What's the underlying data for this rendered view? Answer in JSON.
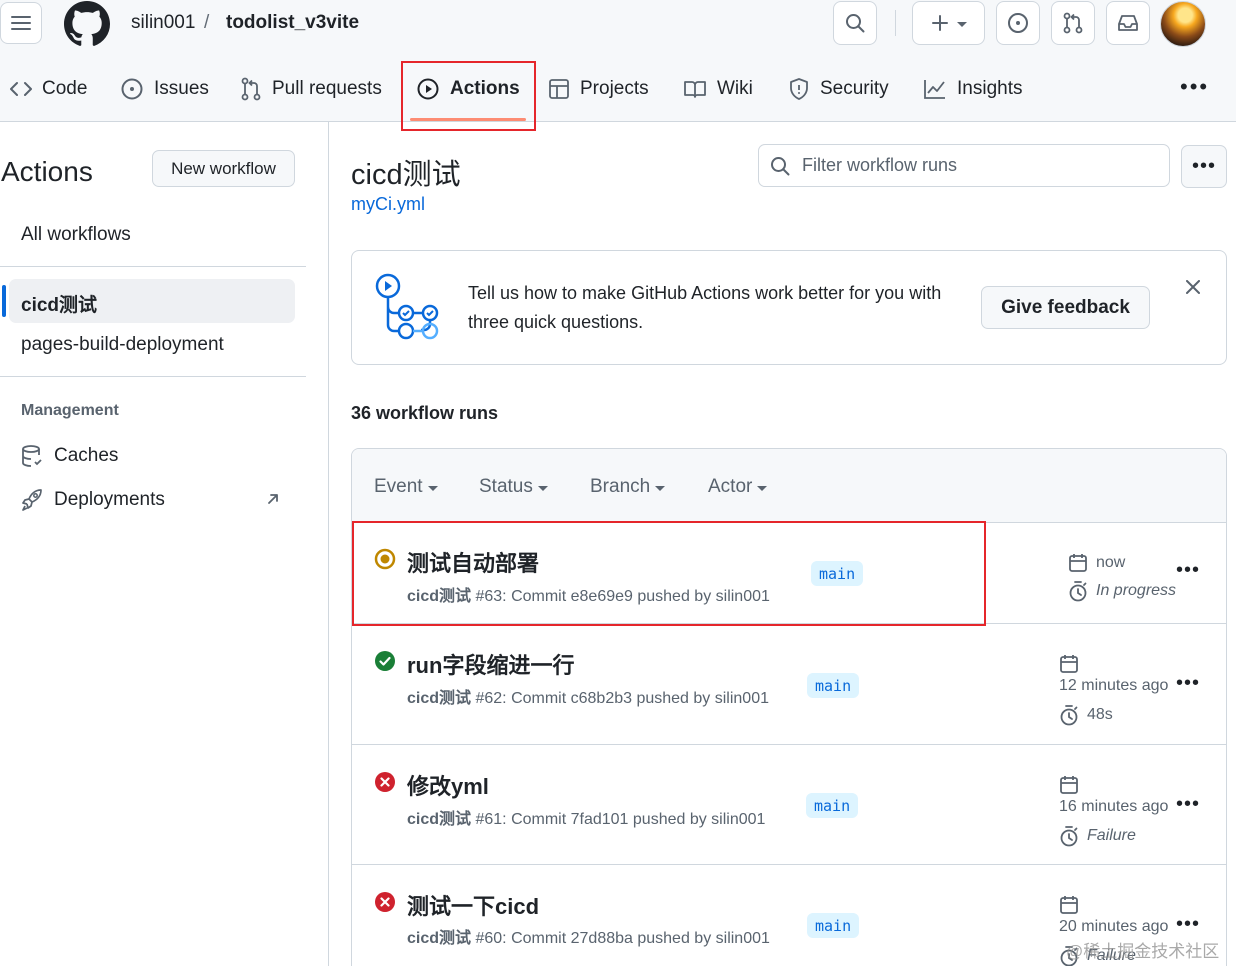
{
  "header": {
    "owner": "silin001",
    "separator": "/",
    "repo": "todolist_v3vite"
  },
  "tabs": [
    {
      "label": "Code",
      "icon": "code-icon"
    },
    {
      "label": "Issues",
      "icon": "issue-icon"
    },
    {
      "label": "Pull requests",
      "icon": "pull-request-icon"
    },
    {
      "label": "Actions",
      "icon": "play-icon",
      "active": true
    },
    {
      "label": "Projects",
      "icon": "table-icon"
    },
    {
      "label": "Wiki",
      "icon": "book-icon"
    },
    {
      "label": "Security",
      "icon": "shield-icon"
    },
    {
      "label": "Insights",
      "icon": "graph-icon"
    }
  ],
  "sidebar": {
    "title": "Actions",
    "new_workflow": "New workflow",
    "all_workflows": "All workflows",
    "workflows": [
      "cicd测试",
      "pages-build-deployment"
    ],
    "management_heading": "Management",
    "management": [
      {
        "label": "Caches",
        "icon": "database-icon"
      },
      {
        "label": "Deployments",
        "icon": "rocket-icon"
      }
    ]
  },
  "main": {
    "workflow_title": "cicd测试",
    "workflow_file": "myCi.yml",
    "filter_placeholder": "Filter workflow runs",
    "feedback": {
      "text": "Tell us how to make GitHub Actions work better for you with three quick questions.",
      "button": "Give feedback"
    },
    "runs_count": "36 workflow runs",
    "filters": [
      "Event",
      "Status",
      "Branch",
      "Actor"
    ],
    "runs": [
      {
        "title": "测试自动部署",
        "workflow": "cicd测试",
        "detail": " #63: Commit e8e69e9 pushed by silin001",
        "branch": "main",
        "time": "now",
        "status_text": "In progress",
        "status": "in-progress",
        "status_color": "#bf8700"
      },
      {
        "title": "run字段缩进一行",
        "workflow": "cicd测试",
        "detail": " #62: Commit c68b2b3 pushed by silin001",
        "branch": "main",
        "time": "12 minutes ago",
        "status_text": "48s",
        "status": "success",
        "status_color": "#1a7f37"
      },
      {
        "title": "修改yml",
        "workflow": "cicd测试",
        "detail": " #61: Commit 7fad101 pushed by silin001",
        "branch": "main",
        "time": "16 minutes ago",
        "status_text": "Failure",
        "status": "failure",
        "status_color": "#cf222e"
      },
      {
        "title": "测试一下cicd",
        "workflow": "cicd测试",
        "detail": " #60: Commit 27d88ba pushed by silin001",
        "branch": "main",
        "time": "20 minutes ago",
        "status_text": "Failure",
        "status": "failure",
        "status_color": "#cf222e"
      }
    ]
  },
  "watermark": "@稀土掘金技术社区",
  "colors": {
    "accent": "#0969da",
    "tab_underline": "#fd8c73",
    "highlight": "#e5262b"
  }
}
